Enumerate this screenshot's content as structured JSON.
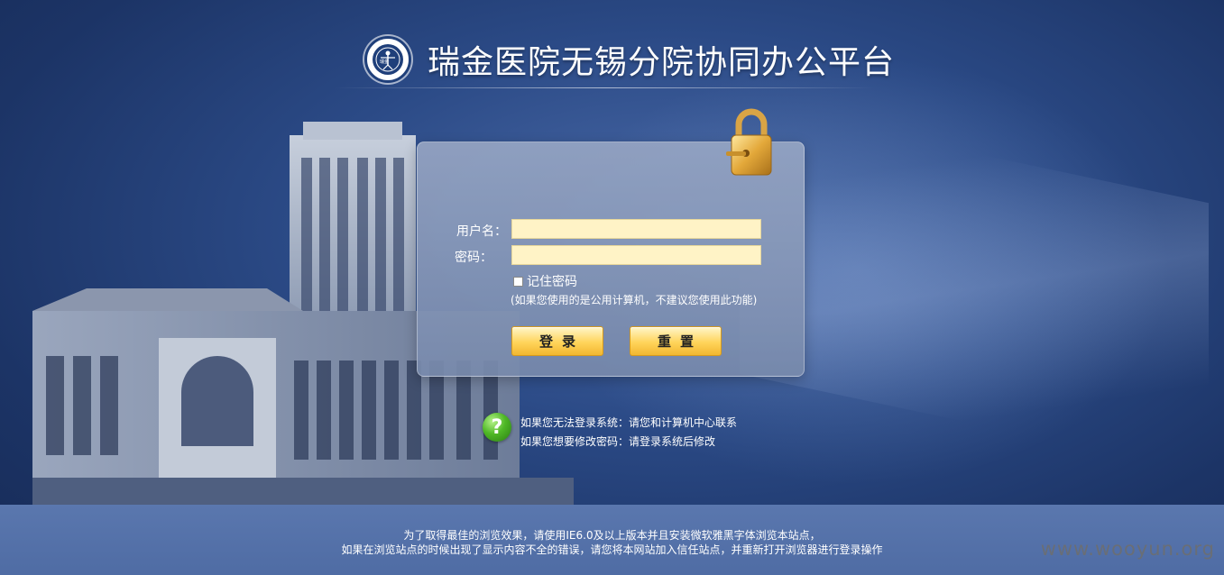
{
  "header": {
    "title": "瑞金医院无锡分院协同办公平台",
    "logo_text": "瑞金"
  },
  "login": {
    "username_label": "用户名：",
    "password_label": "密码：",
    "username_value": "",
    "password_value": "",
    "remember_label": "记住密码",
    "remember_checked": false,
    "remember_hint": "(如果您使用的是公用计算机，不建议您使用此功能)",
    "login_button": "登录",
    "reset_button": "重置"
  },
  "help": {
    "line1": "如果您无法登录系统：请您和计算机中心联系",
    "line2": "如果您想要修改密码：请登录系统后修改"
  },
  "footer": {
    "line1": "为了取得最佳的浏览效果，请使用IE6.0及以上版本并且安装微软雅黑字体浏览本站点，",
    "line2": "如果在浏览站点的时候出现了显示内容不全的错误，请您将本网站加入信任站点，并重新打开浏览器进行登录操作"
  },
  "watermark": "www.wooyun.org",
  "colors": {
    "background": "#2b4a86",
    "input_bg": "#fff3c6",
    "button": "#ffd45a",
    "footer": "#5a77ae"
  }
}
